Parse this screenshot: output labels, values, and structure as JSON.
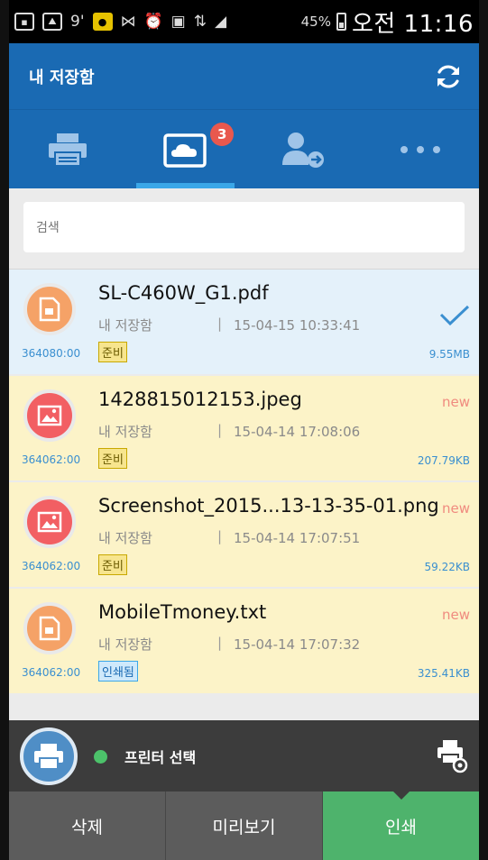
{
  "status_bar": {
    "battery_percent": "45%",
    "time": "오전 11:16",
    "notification_glyph": "9'",
    "icons": [
      "notification-icon",
      "image-icon",
      "kakaotalk-icon",
      "mute-vibrate-icon",
      "alarm-icon",
      "screen-mirror-icon",
      "lte-icon",
      "signal-icon",
      "battery-icon"
    ]
  },
  "header": {
    "title": "내 저장함",
    "refresh_icon": "refresh-icon"
  },
  "tabs": [
    {
      "icon": "printer-icon",
      "active": false
    },
    {
      "icon": "cloud-inbox-icon",
      "active": true,
      "badge": "3"
    },
    {
      "icon": "user-forward-icon",
      "active": false
    },
    {
      "icon": "more-icon",
      "active": false
    }
  ],
  "search": {
    "placeholder": "검색"
  },
  "files": [
    {
      "name": "SL-C460W_G1.pdf",
      "location": "내 저장함",
      "date": "15-04-15 10:33:41",
      "status": "준비",
      "size": "9.55MB",
      "job_id": "364080:00",
      "type": "doc",
      "selected": true,
      "new": ""
    },
    {
      "name": "1428815012153.jpeg",
      "location": "내 저장함",
      "date": "15-04-14 17:08:06",
      "status": "준비",
      "size": "207.79KB",
      "job_id": "364062:00",
      "type": "img",
      "selected": false,
      "new": "new"
    },
    {
      "name": "Screenshot_2015...13-13-35-01.png",
      "location": "내 저장함",
      "date": "15-04-14 17:07:51",
      "status": "준비",
      "size": "59.22KB",
      "job_id": "364062:00",
      "type": "img",
      "selected": false,
      "new": "new"
    },
    {
      "name": "MobileTmoney.txt",
      "location": "내 저장함",
      "date": "15-04-14 17:07:32",
      "status": "인쇄됨",
      "size": "325.41KB",
      "job_id": "364062:00",
      "type": "doc",
      "selected": false,
      "new": "new"
    }
  ],
  "printer_bar": {
    "label": "프린터 선택",
    "status_color": "#4cc26a"
  },
  "actions": {
    "delete": "삭제",
    "preview": "미리보기",
    "print": "인쇄"
  },
  "colors": {
    "primary": "#1a6ab3",
    "tab_indicator": "#3ba7e8",
    "print_button": "#4eb36c",
    "badge": "#e8584e"
  }
}
